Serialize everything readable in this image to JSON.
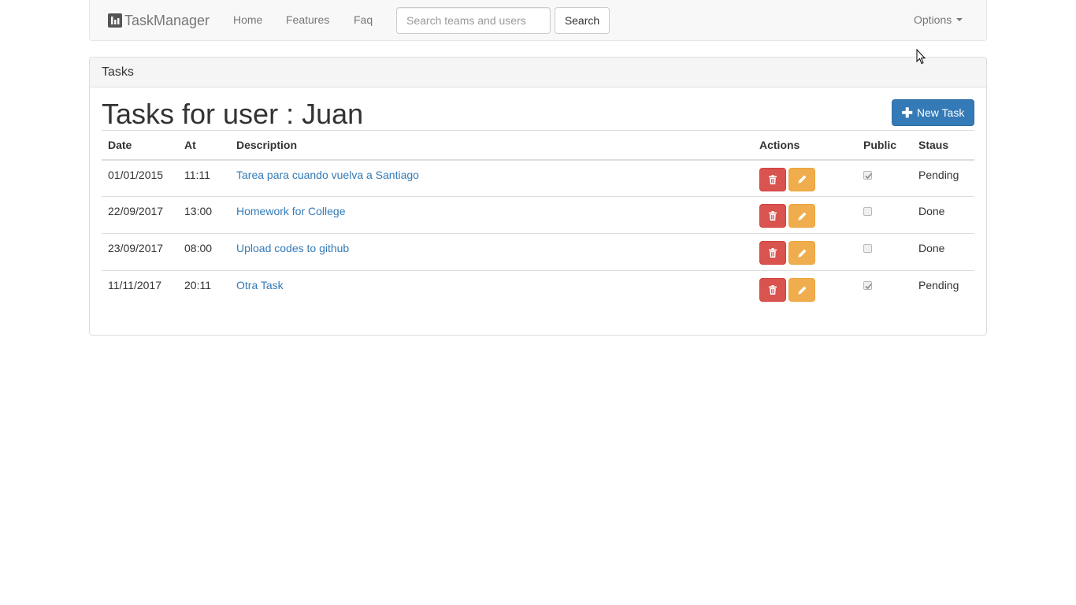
{
  "navbar": {
    "brand": "TaskManager",
    "brand_icon": "bar-chart-icon",
    "links": [
      "Home",
      "Features",
      "Faq"
    ],
    "search": {
      "placeholder": "Search teams and users",
      "value": "",
      "button_label": "Search"
    },
    "options_label": "Options"
  },
  "panel": {
    "heading": "Tasks",
    "title": "Tasks for user : Juan",
    "new_task_label": "New Task"
  },
  "table": {
    "columns": [
      "Date",
      "At",
      "Description",
      "Actions",
      "Public",
      "Staus"
    ],
    "rows": [
      {
        "date": "01/01/2015",
        "at": "11:11",
        "description": "Tarea para cuando vuelva a Santiago",
        "public": true,
        "status": "Pending"
      },
      {
        "date": "22/09/2017",
        "at": "13:00",
        "description": "Homework for College",
        "public": false,
        "status": "Done"
      },
      {
        "date": "23/09/2017",
        "at": "08:00",
        "description": "Upload codes to github",
        "public": false,
        "status": "Done"
      },
      {
        "date": "11/11/2017",
        "at": "20:11",
        "description": "Otra Task",
        "public": true,
        "status": "Pending"
      }
    ]
  },
  "colors": {
    "primary": "#337ab7",
    "danger": "#d9534f",
    "warning": "#f0ad4e",
    "link": "#337ab7"
  }
}
